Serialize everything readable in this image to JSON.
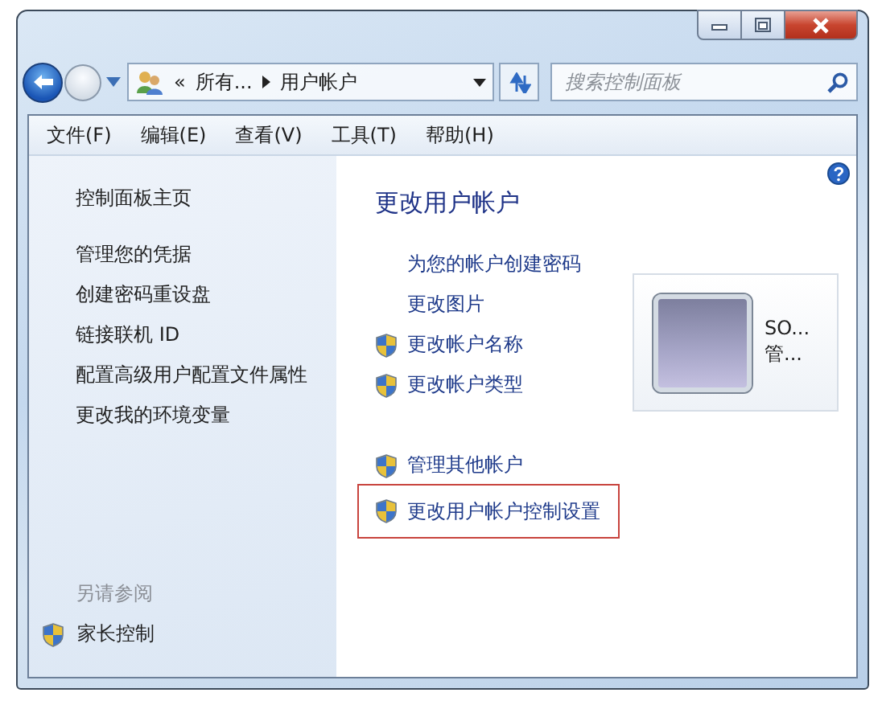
{
  "navigation": {
    "breadcrumb": [
      {
        "kind": "chevron",
        "text": "«"
      },
      {
        "kind": "crumb",
        "text": "所有..."
      },
      {
        "kind": "crumb",
        "text": "用户帐户"
      }
    ],
    "search": {
      "placeholder": "搜索控制面板"
    }
  },
  "menu": [
    "文件(F)",
    "编辑(E)",
    "查看(V)",
    "工具(T)",
    "帮助(H)"
  ],
  "sidebar": {
    "home": "控制面板主页",
    "links": [
      "管理您的凭据",
      "创建密码重设盘",
      "链接联机 ID",
      "配置高级用户配置文件属性",
      "更改我的环境变量"
    ],
    "see_also": {
      "title": "另请参阅",
      "items": [
        {
          "label": "家长控制",
          "shield": true
        }
      ]
    }
  },
  "main": {
    "title": "更改用户帐户",
    "task_groups": [
      {
        "tasks": [
          {
            "label": "为您的帐户创建密码",
            "shield": false,
            "highlighted": false
          },
          {
            "label": "更改图片",
            "shield": false,
            "highlighted": false
          },
          {
            "label": "更改帐户名称",
            "shield": true,
            "highlighted": false
          },
          {
            "label": "更改帐户类型",
            "shield": true,
            "highlighted": false
          }
        ]
      },
      {
        "tasks": [
          {
            "label": "管理其他帐户",
            "shield": true,
            "highlighted": false
          },
          {
            "label": "更改用户帐户控制设置",
            "shield": true,
            "highlighted": true
          }
        ]
      }
    ],
    "account": {
      "name": "SO...",
      "type": "管..."
    }
  }
}
